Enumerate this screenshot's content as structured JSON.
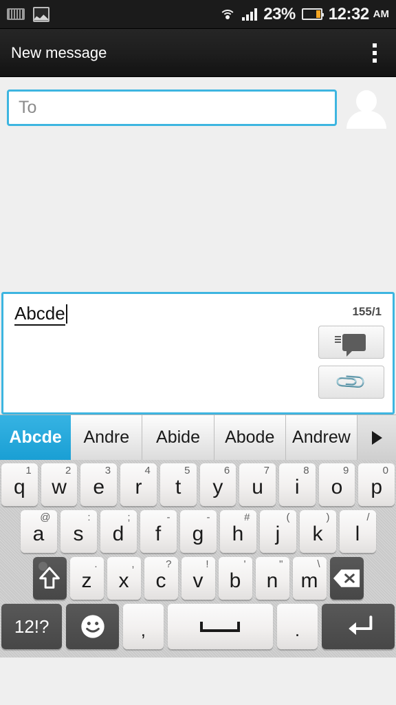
{
  "statusbar": {
    "notification_icons": [
      "keyboard-icon",
      "image-icon"
    ],
    "wifi_icon": "wifi-icon",
    "signal_icon": "signal-bars-icon",
    "battery_percent": "23%",
    "battery_icon": "battery-icon",
    "battery_level": 23,
    "time": "12:32",
    "ampm": "AM"
  },
  "actionbar": {
    "title": "New message",
    "overflow_icon": "overflow-menu-icon"
  },
  "recipient": {
    "to_placeholder": "To",
    "to_value": "",
    "contact_picker_icon": "contact-avatar-icon"
  },
  "compose": {
    "message_text": "Abcde",
    "char_counter": "155/1",
    "send_icon": "send-message-icon",
    "attach_icon": "paperclip-icon"
  },
  "suggestions": {
    "items": [
      {
        "label": "Abcde",
        "selected": true
      },
      {
        "label": "Andre",
        "selected": false
      },
      {
        "label": "Abide",
        "selected": false
      },
      {
        "label": "Abode",
        "selected": false
      },
      {
        "label": "Andrew",
        "selected": false
      }
    ],
    "expand_icon": "expand-suggestions-arrow-icon"
  },
  "keyboard": {
    "row1": [
      {
        "key": "q",
        "alt": "1"
      },
      {
        "key": "w",
        "alt": "2"
      },
      {
        "key": "e",
        "alt": "3"
      },
      {
        "key": "r",
        "alt": "4"
      },
      {
        "key": "t",
        "alt": "5"
      },
      {
        "key": "y",
        "alt": "6"
      },
      {
        "key": "u",
        "alt": "7"
      },
      {
        "key": "i",
        "alt": "8"
      },
      {
        "key": "o",
        "alt": "9"
      },
      {
        "key": "p",
        "alt": "0"
      }
    ],
    "row2": [
      {
        "key": "a",
        "alt": "@"
      },
      {
        "key": "s",
        "alt": ":"
      },
      {
        "key": "d",
        "alt": ";"
      },
      {
        "key": "f",
        "alt": "-"
      },
      {
        "key": "g",
        "alt": "-"
      },
      {
        "key": "h",
        "alt": "#"
      },
      {
        "key": "j",
        "alt": "("
      },
      {
        "key": "k",
        "alt": ")"
      },
      {
        "key": "l",
        "alt": "/"
      }
    ],
    "row3": [
      {
        "key": "z",
        "alt": "."
      },
      {
        "key": "x",
        "alt": ","
      },
      {
        "key": "c",
        "alt": "?"
      },
      {
        "key": "v",
        "alt": "!"
      },
      {
        "key": "b",
        "alt": "'"
      },
      {
        "key": "n",
        "alt": "\""
      },
      {
        "key": "m",
        "alt": "\\"
      }
    ],
    "shift_icon": "shift-key-icon",
    "backspace_icon": "backspace-key-icon",
    "symbols_label": "12!?",
    "emoji_icon": "emoji-key-icon",
    "comma_label": ",",
    "space_icon": "spacebar-key-icon",
    "period_label": ".",
    "enter_icon": "enter-key-icon"
  },
  "colors": {
    "accent": "#3db5e0",
    "suggestion_selected": "#1a9fd4",
    "battery_fill": "#f5a623",
    "statusbar_bg": "#1b1b1b"
  }
}
